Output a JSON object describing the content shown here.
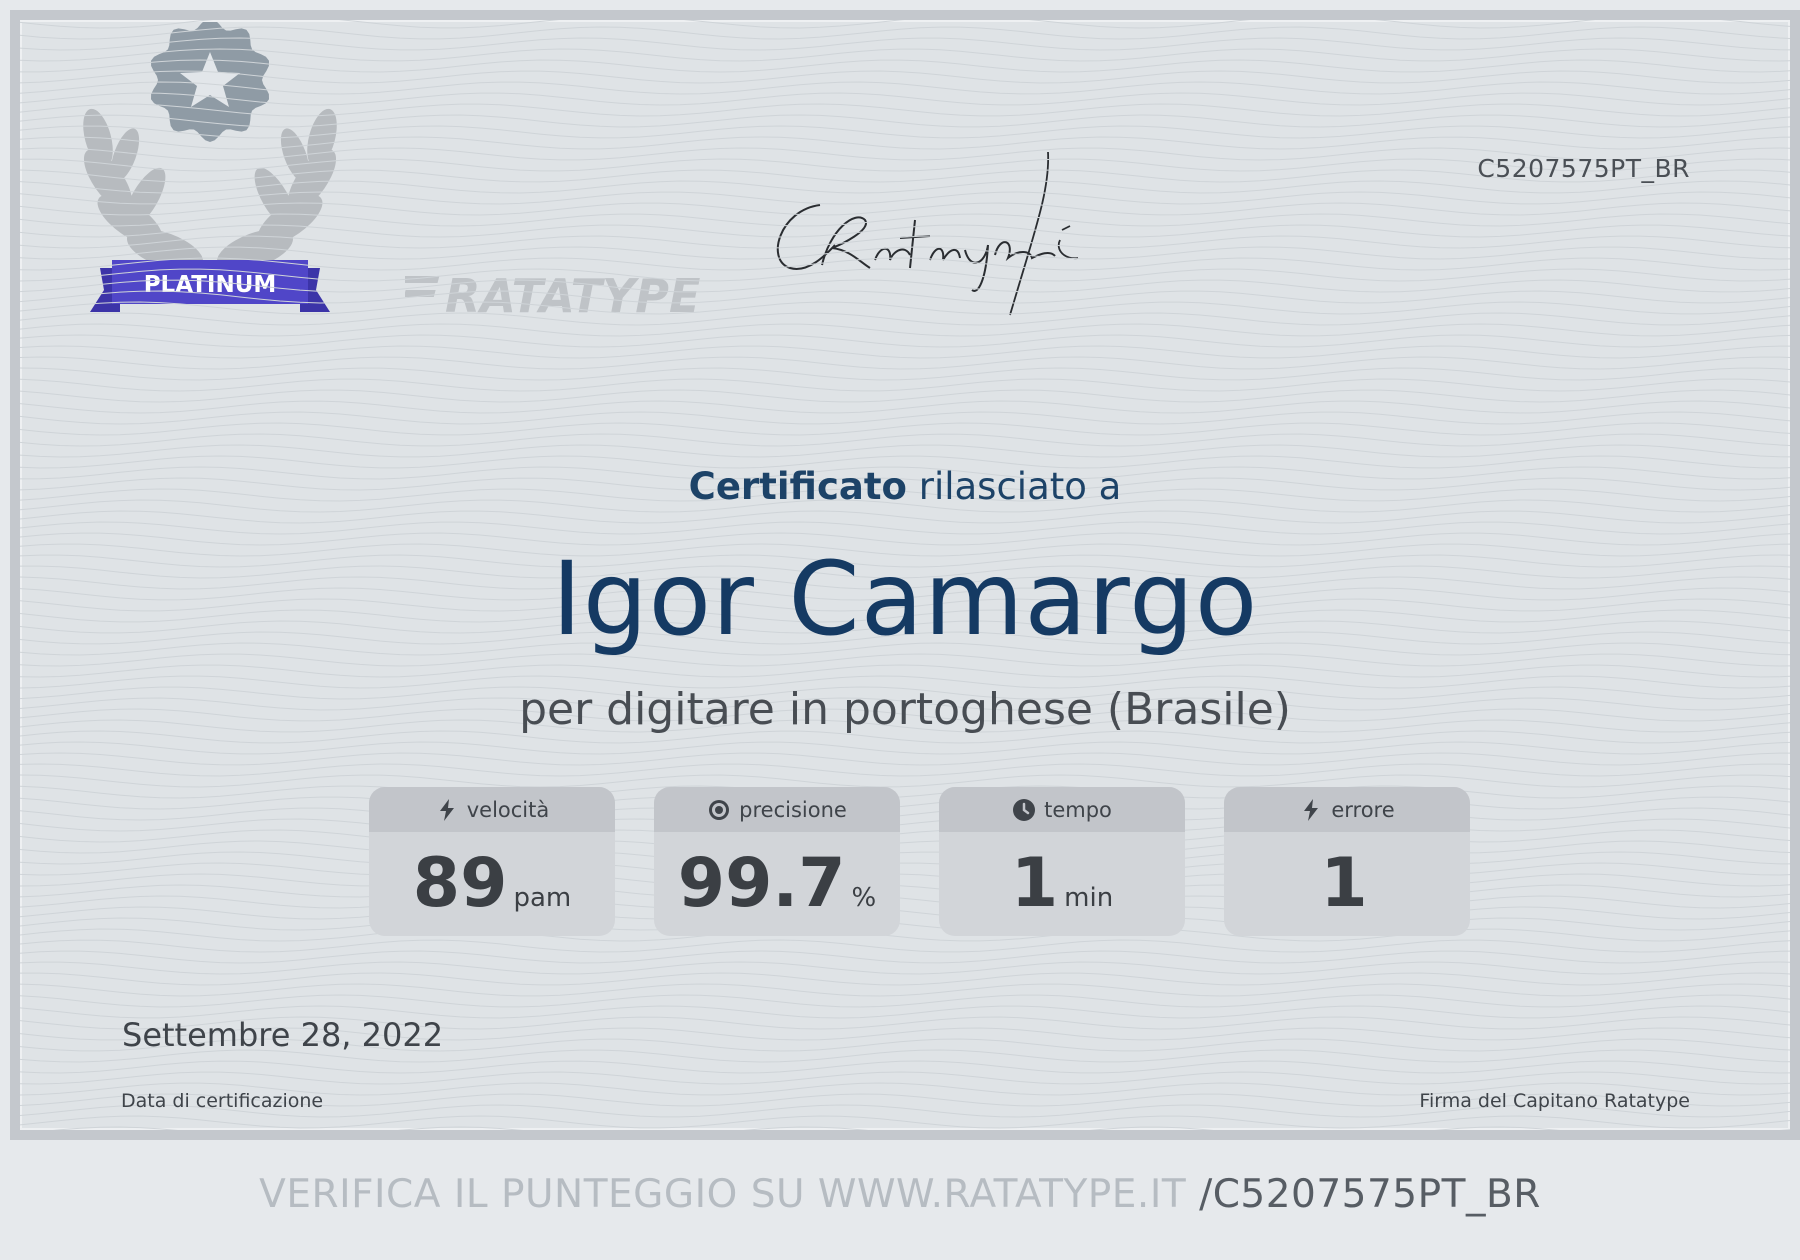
{
  "certificate": {
    "code": "C5207575PT_BR",
    "level": "PLATINUM",
    "heading_strong": "Certificato",
    "heading_rest": " rilasciato a",
    "recipient": "Igor Camargo",
    "course": "per digitare in portoghese (Brasile)"
  },
  "stats": [
    {
      "label": "velocità",
      "value": "89",
      "unit": "pam",
      "icon": "bolt-icon"
    },
    {
      "label": "precisione",
      "value": "99.7",
      "unit": "%",
      "icon": "target-icon"
    },
    {
      "label": "tempo",
      "value": "1",
      "unit": "min",
      "icon": "clock-icon"
    },
    {
      "label": "errore",
      "value": "1",
      "unit": "",
      "icon": "bolt-icon"
    }
  ],
  "footer": {
    "date": "Settembre 28, 2022",
    "date_caption": "Data di certificazione",
    "logo_text": "RATATYPE",
    "signature_caption": "Firma del Capitano Ratatype",
    "signature_text": "CRatatype"
  },
  "verify": {
    "prefix": "VERIFICA IL PUNTEGGIO SU WWW.RATATYPE.IT ",
    "code": "/C5207575PT_BR"
  },
  "colors": {
    "accent_purple": "#5046c8",
    "name_blue": "#153a63",
    "badge_gray": "#8f9ba5"
  }
}
